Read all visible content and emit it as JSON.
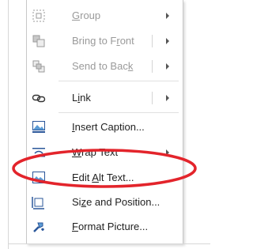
{
  "menu": {
    "group": {
      "pre": "",
      "u": "G",
      "post": "roup",
      "disabled": true
    },
    "bring_to_front": {
      "pre": "Bring to F",
      "u": "r",
      "post": "ont",
      "disabled": true
    },
    "send_to_back": {
      "pre": "Send to Bac",
      "u": "k",
      "post": "",
      "disabled": true
    },
    "link": {
      "pre": "L",
      "u": "i",
      "post": "nk"
    },
    "insert_caption": {
      "pre": "",
      "u": "I",
      "post": "nsert Caption..."
    },
    "wrap_text": {
      "pre": "",
      "u": "W",
      "post": "rap Text"
    },
    "edit_alt_text": {
      "pre": "Edit ",
      "u": "A",
      "post": "lt Text..."
    },
    "size_and_position": {
      "pre": "Si",
      "u": "z",
      "post": "e and Position..."
    },
    "format_picture": {
      "pre": "",
      "u": "F",
      "post": "ormat Picture..."
    }
  },
  "annotation": {
    "ellipse_color": "#e3242b"
  },
  "icons": [
    "group-icon",
    "bring-to-front-icon",
    "send-to-back-icon",
    "link-icon",
    "insert-caption-icon",
    "wrap-text-icon",
    "edit-alt-text-icon",
    "size-position-icon",
    "format-picture-icon"
  ]
}
